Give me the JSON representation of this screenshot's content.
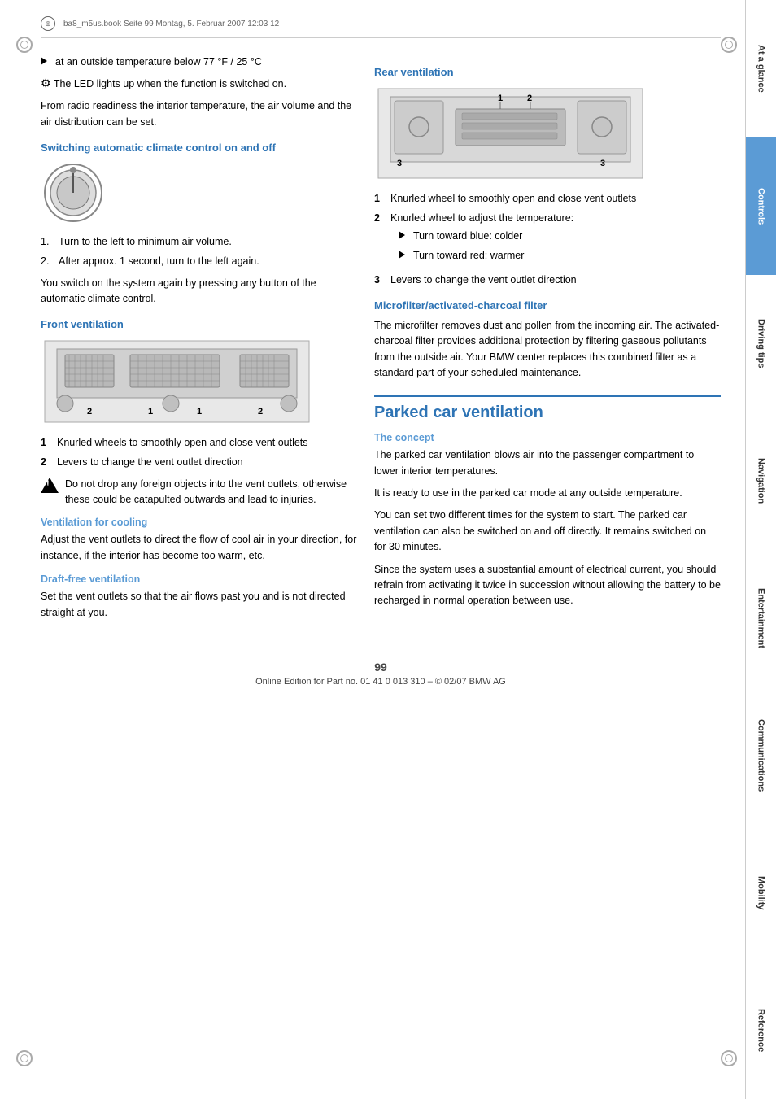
{
  "file_header": {
    "text": "ba8_m5us.book  Seite 99  Montag, 5. Februar 2007  12:03 12"
  },
  "left_col": {
    "bullet1": "at an outside temperature below 77 °F / 25 °C",
    "led_text": "The LED lights up when the function is switched on.",
    "from_radio_text": "From radio readiness the interior temperature, the air volume and the air distribution can be set.",
    "switching_heading": "Switching automatic climate control on and off",
    "step1": "Turn to the left to minimum air volume.",
    "step2": "After approx. 1 second, turn to the left again.",
    "you_switch_text": "You switch on the system again by pressing any button of the automatic climate control.",
    "front_vent_heading": "Front ventilation",
    "front_num1": "Knurled wheels to smoothly open and close vent outlets",
    "front_num2": "Levers to change the vent outlet direction",
    "warning_text": "Do not drop any foreign objects into the vent outlets, otherwise these could be catapulted outwards and lead to injuries.",
    "vent_for_cooling_heading": "Ventilation for cooling",
    "vent_for_cooling_text": "Adjust the vent outlets to direct the flow of cool air in your direction, for instance, if the interior has become too warm, etc.",
    "draft_free_heading": "Draft-free ventilation",
    "draft_free_text": "Set the vent outlets so that the air flows past you and is not directed straight at you."
  },
  "right_col": {
    "rear_vent_heading": "Rear ventilation",
    "rear_num1": "Knurled wheel to smoothly open and close vent outlets",
    "rear_num2": "Knurled wheel to adjust the temperature:",
    "rear_num2_sub1": "Turn toward blue: colder",
    "rear_num2_sub2": "Turn toward red: warmer",
    "rear_num3": "Levers to change the vent outlet direction",
    "microfilter_heading": "Microfilter/activated-charcoal filter",
    "microfilter_text": "The microfilter removes dust and pollen from the incoming air. The activated-charcoal filter provides additional protection by filtering gaseous pollutants from the outside air. Your BMW center replaces this combined filter as a standard part of your scheduled maintenance.",
    "parked_car_heading": "Parked car ventilation",
    "concept_heading": "The concept",
    "concept_p1": "The parked car ventilation blows air into the passenger compartment to lower interior temperatures.",
    "concept_p2": "It is ready to use in the parked car mode at any outside temperature.",
    "concept_p3": "You can set two different times for the system to start. The parked car ventilation can also be switched on and off directly. It remains switched on for 30 minutes.",
    "concept_p4": "Since the system uses a substantial amount of electrical current, you should refrain from activating it twice in succession without allowing the battery to be recharged in normal operation between use."
  },
  "tabs": [
    {
      "label": "At a glance",
      "active": false
    },
    {
      "label": "Controls",
      "active": true
    },
    {
      "label": "Driving tips",
      "active": false
    },
    {
      "label": "Navigation",
      "active": false
    },
    {
      "label": "Entertainment",
      "active": false
    },
    {
      "label": "Communications",
      "active": false
    },
    {
      "label": "Mobility",
      "active": false
    },
    {
      "label": "Reference",
      "active": false
    }
  ],
  "footer": {
    "page_number": "99",
    "online_text": "Online Edition for Part no. 01 41 0 013 310 – © 02/07 BMW AG"
  },
  "front_vent_labels": {
    "num1": "1",
    "num2": "2",
    "label_desc": "2  1  1  2"
  },
  "rear_vent_labels": {
    "num1": "1",
    "num2": "2",
    "num3": "3"
  }
}
